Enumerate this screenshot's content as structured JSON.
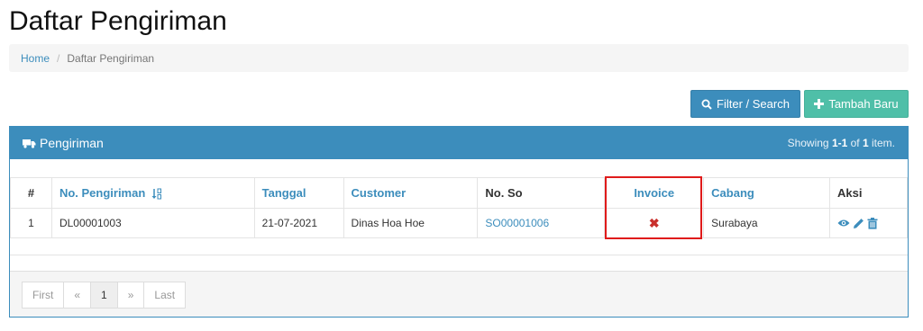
{
  "page": {
    "title": "Daftar Pengiriman"
  },
  "breadcrumb": {
    "home": "Home",
    "separator": "/",
    "current": "Daftar Pengiriman"
  },
  "toolbar": {
    "filter_label": "Filter / Search",
    "add_label": "Tambah Baru"
  },
  "panel": {
    "title": "Pengiriman",
    "summary_prefix": "Showing ",
    "summary_range": "1-1",
    "summary_mid": " of ",
    "summary_total": "1",
    "summary_suffix": " item."
  },
  "table": {
    "headers": [
      "#",
      "No. Pengiriman",
      "Tanggal",
      "Customer",
      "No. So",
      "Invoice",
      "Cabang",
      "Aksi"
    ],
    "rows": [
      {
        "no": "1",
        "no_pengiriman": "DL00001003",
        "tanggal": "21-07-2021",
        "customer": "Dinas Hoa Hoe",
        "no_so": "SO00001006",
        "invoice": "✖",
        "cabang": "Surabaya"
      }
    ]
  },
  "pagination": {
    "first": "First",
    "prev": "«",
    "current": "1",
    "next": "»",
    "last": "Last"
  },
  "icons": {
    "filter": "search-icon",
    "add": "plus-icon",
    "panel": "truck-icon",
    "sort": "sort-numeric-icon",
    "view": "eye-icon",
    "edit": "pencil-icon",
    "delete": "trash-icon"
  },
  "colors": {
    "primary": "#3c8dbc",
    "success": "#4fbfa8",
    "danger": "#c9302c",
    "highlight": "#e01b1b"
  }
}
